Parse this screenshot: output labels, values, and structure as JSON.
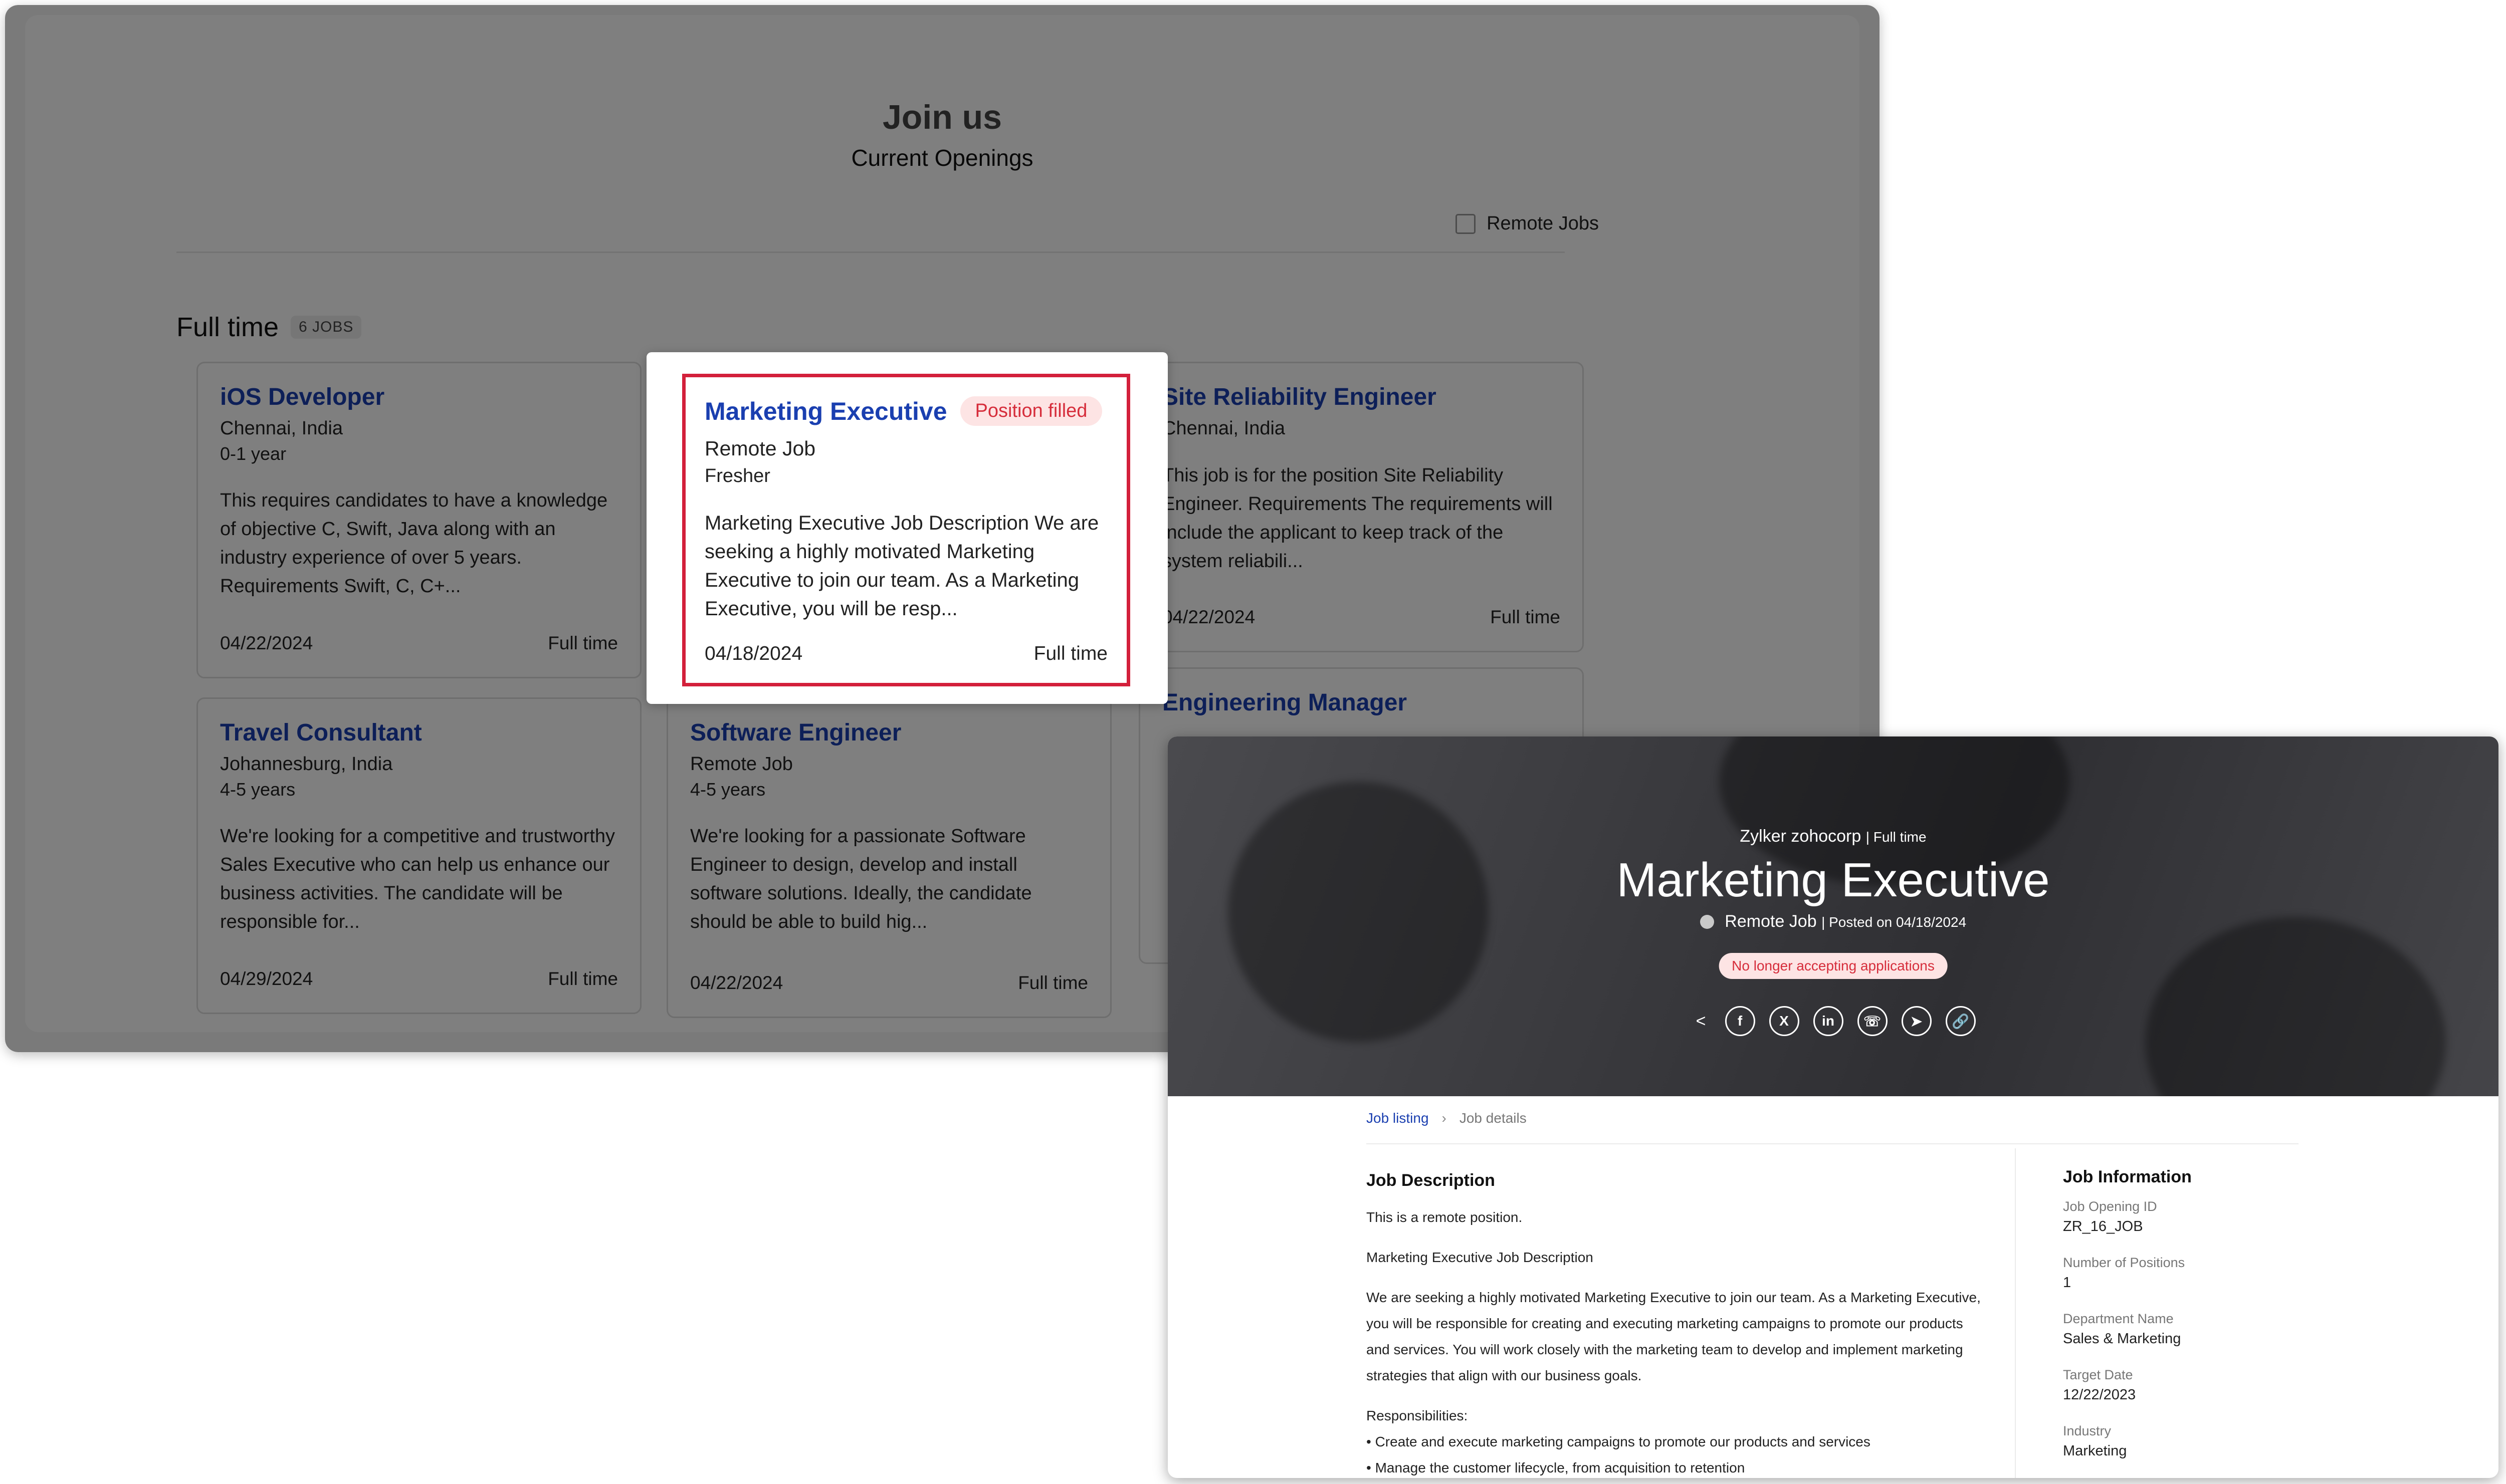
{
  "careers": {
    "title": "Join us",
    "subtitle": "Current Openings",
    "remote_filter_label": "Remote Jobs",
    "section_title": "Full time",
    "section_count": "6 JOBS",
    "jobs": [
      {
        "title": "iOS Developer",
        "location": "Chennai, India",
        "experience": "0-1 year",
        "description": "This requires candidates to have a knowledge of objective C, Swift, Java along with an industry experience of over 5 years. Requirements Swift, C, C+...",
        "date": "04/22/2024",
        "type": "Full time"
      },
      {
        "title": "Marketing Executive",
        "badge": "Position filled",
        "location": "Remote Job",
        "experience": "Fresher",
        "description": "Marketing Executive Job Description We are seeking a highly motivated Marketing Executive to join our team. As a Marketing Executive, you will be resp...",
        "date": "04/18/2024",
        "type": "Full time"
      },
      {
        "title": "Site Reliability Engineer",
        "location": "Chennai, India",
        "description": "This job is for the position Site Reliability Engineer. Requirements The requirements will include the applicant to keep track of the system reliabili...",
        "date": "04/22/2024",
        "type": "Full time"
      },
      {
        "title": "Travel Consultant",
        "location": "Johannesburg, India",
        "experience": "4-5 years",
        "description": "We're looking for a competitive and trustworthy Sales Executive who can help us enhance our business activities. The candidate will be responsible for...",
        "date": "04/29/2024",
        "type": "Full time"
      },
      {
        "title": "Software Engineer",
        "location": "Remote Job",
        "experience": "4-5 years",
        "description": "We're looking for a passionate Software Engineer to design, develop and install software solutions. Ideally, the candidate should be able to build hig...",
        "date": "04/22/2024",
        "type": "Full time"
      },
      {
        "title": "Engineering Manager"
      }
    ]
  },
  "detail": {
    "company": "Zylker zohocorp",
    "job_type": "| Full time",
    "title": "Marketing Executive",
    "location": "Remote Job",
    "posted": "| Posted on 04/18/2024",
    "status_badge": "No longer accepting applications",
    "share_icons": [
      "share-icon",
      "facebook-icon",
      "x-icon",
      "linkedin-icon",
      "whatsapp-icon",
      "telegram-icon",
      "link-icon"
    ],
    "share_glyphs": [
      "<",
      "f",
      "X",
      "in",
      "☏",
      "➤",
      "🔗"
    ],
    "breadcrumb": {
      "listing": "Job listing",
      "current": "Job details"
    },
    "description": {
      "heading": "Job Description",
      "p1": "This is a remote position.",
      "p2": "Marketing Executive Job Description",
      "p3": "We are seeking a highly motivated Marketing Executive to join our team. As a Marketing Executive, you will be responsible for creating and executing marketing campaigns to promote our products and services. You will work closely with the marketing team to develop and implement marketing strategies that align with our business goals.",
      "resp_heading": "Responsibilities:",
      "resp": [
        "• Create and execute marketing campaigns to promote our products and services",
        "• Manage the customer lifecycle, from acquisition to retention"
      ]
    },
    "info": {
      "heading": "Job Information",
      "fields": [
        {
          "label": "Job Opening ID",
          "value": "ZR_16_JOB"
        },
        {
          "label": "Number of Positions",
          "value": "1"
        },
        {
          "label": "Department Name",
          "value": "Sales & Marketing"
        },
        {
          "label": "Target Date",
          "value": "12/22/2023"
        },
        {
          "label": "Industry",
          "value": "Marketing"
        }
      ]
    }
  },
  "colors": {
    "link_blue": "#1a3fb0",
    "filled_red": "#d62d3b",
    "highlight_border": "#d3203b"
  }
}
